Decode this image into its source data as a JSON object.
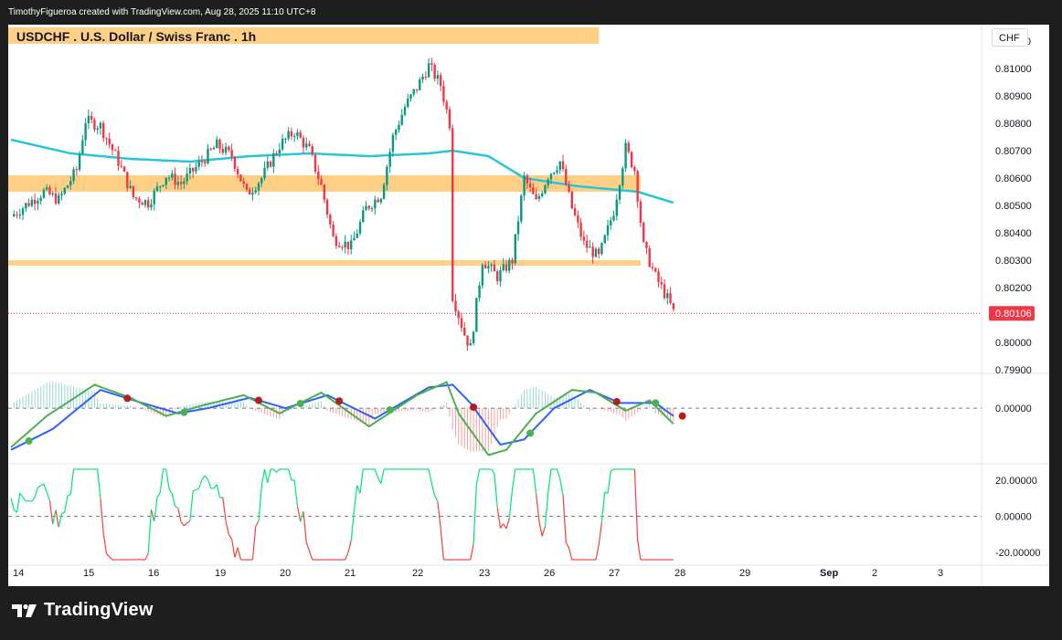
{
  "header": {
    "credit": "TimothyFigueroa created with TradingView.com, Aug 28, 2025 11:10 UTC+8"
  },
  "footer": {
    "brand": "TradingView"
  },
  "chart_data": [
    {
      "type": "candlestick",
      "title": "USDCHF . U.S. Dollar / Swiss Franc . 1h",
      "currency": "CHF",
      "ylim": [
        0.7989,
        0.8116
      ],
      "y_ticks": [
        "0.81100",
        "0.81000",
        "0.80900",
        "0.80800",
        "0.80700",
        "0.80600",
        "0.80500",
        "0.80400",
        "0.80300",
        "0.80200",
        "0.80000",
        "0.79900"
      ],
      "y_tick_values": [
        0.811,
        0.81,
        0.809,
        0.808,
        0.807,
        0.806,
        0.805,
        0.804,
        0.803,
        0.802,
        0.8,
        0.799
      ],
      "last_price": "0.80106",
      "last_price_value": 0.80106,
      "x_labels": [
        "14",
        "15",
        "16",
        "19",
        "20",
        "21",
        "22",
        "23",
        "26",
        "27",
        "28",
        "29",
        "Sep",
        "2",
        "3"
      ],
      "close_anchors": [
        {
          "t": 0,
          "p": 0.8046
        },
        {
          "t": 6,
          "p": 0.8051
        },
        {
          "t": 11,
          "p": 0.8055
        },
        {
          "t": 16,
          "p": 0.8052
        },
        {
          "t": 22,
          "p": 0.8063
        },
        {
          "t": 25,
          "p": 0.8081
        },
        {
          "t": 30,
          "p": 0.8079
        },
        {
          "t": 36,
          "p": 0.8066
        },
        {
          "t": 41,
          "p": 0.8053
        },
        {
          "t": 46,
          "p": 0.8051
        },
        {
          "t": 52,
          "p": 0.8061
        },
        {
          "t": 57,
          "p": 0.8058
        },
        {
          "t": 63,
          "p": 0.8065
        },
        {
          "t": 69,
          "p": 0.8072
        },
        {
          "t": 74,
          "p": 0.8068
        },
        {
          "t": 79,
          "p": 0.8054
        },
        {
          "t": 84,
          "p": 0.806
        },
        {
          "t": 90,
          "p": 0.8072
        },
        {
          "t": 95,
          "p": 0.8077
        },
        {
          "t": 100,
          "p": 0.807
        },
        {
          "t": 104,
          "p": 0.8057
        },
        {
          "t": 108,
          "p": 0.8038
        },
        {
          "t": 114,
          "p": 0.8035
        },
        {
          "t": 119,
          "p": 0.8049
        },
        {
          "t": 124,
          "p": 0.8054
        },
        {
          "t": 128,
          "p": 0.8075
        },
        {
          "t": 132,
          "p": 0.8086
        },
        {
          "t": 136,
          "p": 0.8093
        },
        {
          "t": 140,
          "p": 0.8101
        },
        {
          "t": 144,
          "p": 0.8094
        },
        {
          "t": 147,
          "p": 0.808
        },
        {
          "t": 148,
          "p": 0.8017
        },
        {
          "t": 152,
          "p": 0.8003
        },
        {
          "t": 154,
          "p": 0.7998
        },
        {
          "t": 158,
          "p": 0.803
        },
        {
          "t": 163,
          "p": 0.8024
        },
        {
          "t": 168,
          "p": 0.803
        },
        {
          "t": 172,
          "p": 0.806
        },
        {
          "t": 176,
          "p": 0.8051
        },
        {
          "t": 180,
          "p": 0.8061
        },
        {
          "t": 184,
          "p": 0.8066
        },
        {
          "t": 188,
          "p": 0.8049
        },
        {
          "t": 192,
          "p": 0.8036
        },
        {
          "t": 197,
          "p": 0.8031
        },
        {
          "t": 202,
          "p": 0.8048
        },
        {
          "t": 206,
          "p": 0.8071
        },
        {
          "t": 209,
          "p": 0.8063
        },
        {
          "t": 212,
          "p": 0.8035
        },
        {
          "t": 216,
          "p": 0.8024
        },
        {
          "t": 220,
          "p": 0.8016
        },
        {
          "t": 222,
          "p": 0.8011
        }
      ],
      "ma_anchors": [
        {
          "t": 0,
          "p": 0.8074
        },
        {
          "t": 20,
          "p": 0.8069
        },
        {
          "t": 40,
          "p": 0.8067
        },
        {
          "t": 60,
          "p": 0.8066
        },
        {
          "t": 80,
          "p": 0.8068
        },
        {
          "t": 100,
          "p": 0.8069
        },
        {
          "t": 120,
          "p": 0.8068
        },
        {
          "t": 140,
          "p": 0.8069
        },
        {
          "t": 148,
          "p": 0.807
        },
        {
          "t": 160,
          "p": 0.8068
        },
        {
          "t": 172,
          "p": 0.806
        },
        {
          "t": 190,
          "p": 0.8057
        },
        {
          "t": 210,
          "p": 0.8055
        },
        {
          "t": 222,
          "p": 0.8051
        }
      ],
      "zones": [
        {
          "low": 0.8109,
          "high": 0.8115,
          "t_end": 197
        },
        {
          "low": 0.8055,
          "high": 0.8061,
          "t_end": 211
        },
        {
          "low": 0.8028,
          "high": 0.803,
          "t_end": 211
        }
      ]
    },
    {
      "type": "line",
      "title": "",
      "ylim": [
        -2.1,
        1.3
      ],
      "y_ticks": [
        "0.00000"
      ],
      "y_tick_values": [
        0
      ],
      "series": [
        {
          "color": "#4caf50",
          "values_anchors": [
            [
              0,
              -1.5
            ],
            [
              12,
              -0.3
            ],
            [
              28,
              0.9
            ],
            [
              40,
              0.4
            ],
            [
              52,
              -0.3
            ],
            [
              64,
              0.1
            ],
            [
              78,
              0.5
            ],
            [
              90,
              -0.2
            ],
            [
              104,
              0.6
            ],
            [
              120,
              -0.7
            ],
            [
              136,
              0.5
            ],
            [
              146,
              1.0
            ],
            [
              150,
              -0.2
            ],
            [
              160,
              -1.8
            ],
            [
              166,
              -1.6
            ],
            [
              176,
              -0.2
            ],
            [
              188,
              0.7
            ],
            [
              196,
              0.6
            ],
            [
              206,
              -0.1
            ],
            [
              214,
              0.3
            ],
            [
              222,
              -0.6
            ]
          ]
        },
        {
          "color": "#2962ff",
          "values_anchors": [
            [
              0,
              -1.6
            ],
            [
              14,
              -0.8
            ],
            [
              30,
              0.7
            ],
            [
              44,
              0.2
            ],
            [
              56,
              -0.2
            ],
            [
              66,
              0.0
            ],
            [
              80,
              0.4
            ],
            [
              92,
              0.0
            ],
            [
              106,
              0.5
            ],
            [
              122,
              -0.4
            ],
            [
              140,
              0.8
            ],
            [
              148,
              0.9
            ],
            [
              154,
              0.2
            ],
            [
              164,
              -1.4
            ],
            [
              172,
              -1.2
            ],
            [
              182,
              0.0
            ],
            [
              194,
              0.7
            ],
            [
              204,
              0.2
            ],
            [
              216,
              0.2
            ],
            [
              222,
              -0.3
            ]
          ]
        }
      ]
    },
    {
      "type": "line",
      "title": "",
      "ylim": [
        -26,
        28
      ],
      "y_ticks": [
        "20.00000",
        "0.00000",
        "-20.00000"
      ],
      "y_tick_values": [
        20,
        0,
        -20
      ]
    }
  ]
}
